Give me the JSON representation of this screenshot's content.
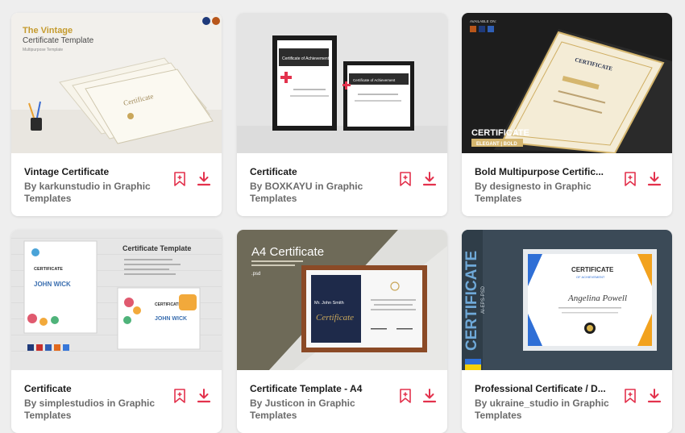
{
  "colors": {
    "accent": "#e3324d",
    "page_bg": "#eeeeee",
    "card_bg": "#ffffff"
  },
  "icons": {
    "bookmark": "bookmark-icon",
    "download": "download-icon"
  },
  "cards": [
    {
      "title": "Vintage Certificate",
      "byline": "By karkunstudio in Graphic Templates",
      "thumb_text": {
        "line1": "The Vintage",
        "line2": "Certificate Template",
        "line3": "Multipurpose Template"
      }
    },
    {
      "title": "Certificate",
      "byline": "By BOXKAYU in Graphic Templates",
      "thumb_text": {
        "frame1": "Certificate of Achievement",
        "frame2": "Certificate of Achievement"
      }
    },
    {
      "title": "Bold Multipurpose Certific...",
      "byline": "By designesto in Graphic Templates",
      "thumb_text": {
        "badge": "AVAILABLE ON:",
        "cert": "CERTIFICATE",
        "heading": "CERTIFICATE",
        "sub": "ELEGANT | BOLD"
      }
    },
    {
      "title": "Certificate",
      "byline": "By simplestudios in Graphic Templates",
      "thumb_text": {
        "heading": "Certificate Template",
        "cert": "CERTIFICATE",
        "name": "JOHN WICK",
        "cert2": "CERTIFICATE",
        "name2": "JOHN WICK"
      }
    },
    {
      "title": "Certificate Template - A4",
      "byline": "By Justicon in Graphic Templates",
      "thumb_text": {
        "heading": "A4 Certificate",
        "format": ".psd",
        "name": "Mr. John Smith",
        "script": "Certificate"
      }
    },
    {
      "title": "Professional Certificate / D...",
      "byline": "By ukraine_studio in Graphic Templates",
      "thumb_text": {
        "vertical": "CERTIFICATE",
        "formats": "AI-EPS-PSD",
        "cert": "CERTIFICATE",
        "sub": "OF ACHIEVEMENT",
        "name": "Angelina Powell"
      }
    }
  ]
}
